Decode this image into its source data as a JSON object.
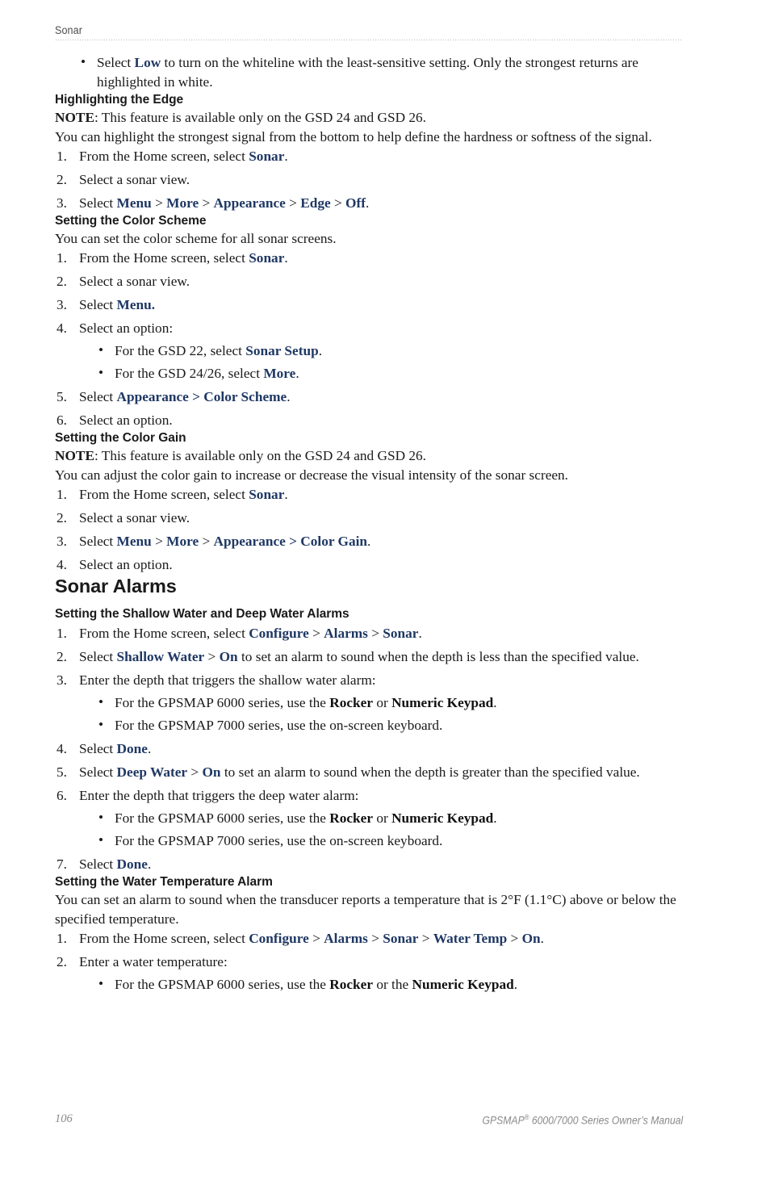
{
  "header": {
    "title": "Sonar"
  },
  "footer": {
    "page_number": "106",
    "manual_prefix": "GPSMAP",
    "manual_mark": "®",
    "manual_suffix": " 6000/7000 Series Owner’s Manual"
  },
  "colors": {
    "ui_term_blue": "#1F3864",
    "body_text": "#1a1a1a",
    "header_gray": "#4d4d4d",
    "footer_gray": "#8a8a8a"
  },
  "intro_bullet": {
    "pre": "Select ",
    "term": "Low",
    "post": " to turn on the whiteline with the least-sensitive setting. Only the strongest returns are highlighted in white."
  },
  "sections": [
    {
      "id": "highlighting-the-edge",
      "heading": "Highlighting the Edge",
      "note_label": "NOTE",
      "note_text": ": This feature is available only on the GSD 24 and GSD 26.",
      "intro": "You can highlight the strongest signal from the bottom to help define the hardness or softness of the signal.",
      "steps": [
        {
          "num": "1.",
          "pre": "From the Home screen, select ",
          "term": "Sonar",
          "post": "."
        },
        {
          "num": "2.",
          "pre": "Select a sonar view.",
          "term": "",
          "post": ""
        },
        {
          "num": "3.",
          "pre": "Select ",
          "path": [
            "Menu",
            "More",
            "Appearance",
            "Edge",
            "Off"
          ],
          "post": "."
        }
      ]
    },
    {
      "id": "setting-the-color-scheme",
      "heading": "Setting the Color Scheme",
      "intro": "You can set the color scheme for all sonar screens.",
      "steps": [
        {
          "num": "1.",
          "pre": "From the Home screen, select ",
          "term": "Sonar",
          "post": "."
        },
        {
          "num": "2.",
          "pre": "Select a sonar view.",
          "term": "",
          "post": ""
        },
        {
          "num": "3.",
          "pre": "Select ",
          "term": "Menu.",
          "post": ""
        },
        {
          "num": "4.",
          "pre": "Select an option:",
          "term": "",
          "post": "",
          "bullets": [
            {
              "pre": "For the GSD 22, select ",
              "term": "Sonar Setup",
              "post": "."
            },
            {
              "pre": "For the GSD 24/26, select ",
              "term": "More",
              "post": "."
            }
          ]
        },
        {
          "num": "5.",
          "pre": "Select ",
          "term": "Appearance > Color Scheme",
          "post": "."
        },
        {
          "num": "6.",
          "pre": "Select an option.",
          "term": "",
          "post": ""
        }
      ]
    },
    {
      "id": "setting-the-color-gain",
      "heading": "Setting the Color Gain",
      "note_label": "NOTE",
      "note_text": ": This feature is available only on the GSD 24 and GSD 26.",
      "intro": "You can adjust the color gain to increase or decrease the visual intensity of the sonar screen.",
      "steps": [
        {
          "num": "1.",
          "pre": "From the Home screen, select ",
          "term": "Sonar",
          "post": "."
        },
        {
          "num": "2.",
          "pre": "Select a sonar view.",
          "term": "",
          "post": ""
        },
        {
          "num": "3.",
          "pre": "Select ",
          "path": [
            "Menu",
            "More",
            "Appearance > Color Gain"
          ],
          "post": "."
        },
        {
          "num": "4.",
          "pre": "Select an option.",
          "term": "",
          "post": ""
        }
      ]
    }
  ],
  "major_heading": "Sonar Alarms",
  "alarm_sections": [
    {
      "id": "shallow-deep-water-alarms",
      "heading": "Setting the Shallow Water and Deep Water Alarms",
      "steps": [
        {
          "num": "1.",
          "pre": "From the Home screen, select ",
          "path": [
            "Configure",
            "Alarms",
            "Sonar"
          ],
          "post": "."
        },
        {
          "num": "2.",
          "pre": "Select ",
          "path": [
            "Shallow Water",
            "On"
          ],
          "post": " to set an alarm to sound when the depth is less than the specified value."
        },
        {
          "num": "3.",
          "pre": "Enter the depth that triggers the shallow water alarm:",
          "post": "",
          "bullets": [
            {
              "pre": "For the GPSMAP 6000 series, use the ",
              "kb1": "Rocker",
              "mid": " or ",
              "kb2": "Numeric Keypad",
              "post": "."
            },
            {
              "pre": "For the GPSMAP 7000 series, use the on-screen keyboard.",
              "post": ""
            }
          ]
        },
        {
          "num": "4.",
          "pre": "Select ",
          "term": "Done",
          "post": "."
        },
        {
          "num": "5.",
          "pre": "Select ",
          "path": [
            "Deep Water",
            "On"
          ],
          "post": " to set an alarm to sound when the depth is greater than the specified value."
        },
        {
          "num": "6.",
          "pre": "Enter the depth that triggers the deep water alarm:",
          "post": "",
          "bullets": [
            {
              "pre": "For the GPSMAP 6000 series, use the ",
              "kb1": "Rocker",
              "mid": " or ",
              "kb2": "Numeric Keypad",
              "post": "."
            },
            {
              "pre": "For the GPSMAP 7000 series, use the on-screen keyboard.",
              "post": ""
            }
          ]
        },
        {
          "num": "7.",
          "pre": "Select ",
          "term": "Done",
          "post": "."
        }
      ]
    },
    {
      "id": "water-temperature-alarm",
      "heading": "Setting the Water Temperature Alarm",
      "intro": "You can set an alarm to sound when the transducer reports a temperature that is 2°F (1.1°C) above or below the specified temperature.",
      "steps": [
        {
          "num": "1.",
          "pre": "From the Home screen, select ",
          "path": [
            "Configure",
            "Alarms",
            "Sonar",
            "Water Temp",
            "On"
          ],
          "post": "."
        },
        {
          "num": "2.",
          "pre": "Enter a water temperature:",
          "post": "",
          "bullets": [
            {
              "pre": "For the GPSMAP 6000 series, use the ",
              "kb1": "Rocker",
              "mid": " or the ",
              "kb2": "Numeric Keypad",
              "post": "."
            }
          ]
        }
      ]
    }
  ]
}
